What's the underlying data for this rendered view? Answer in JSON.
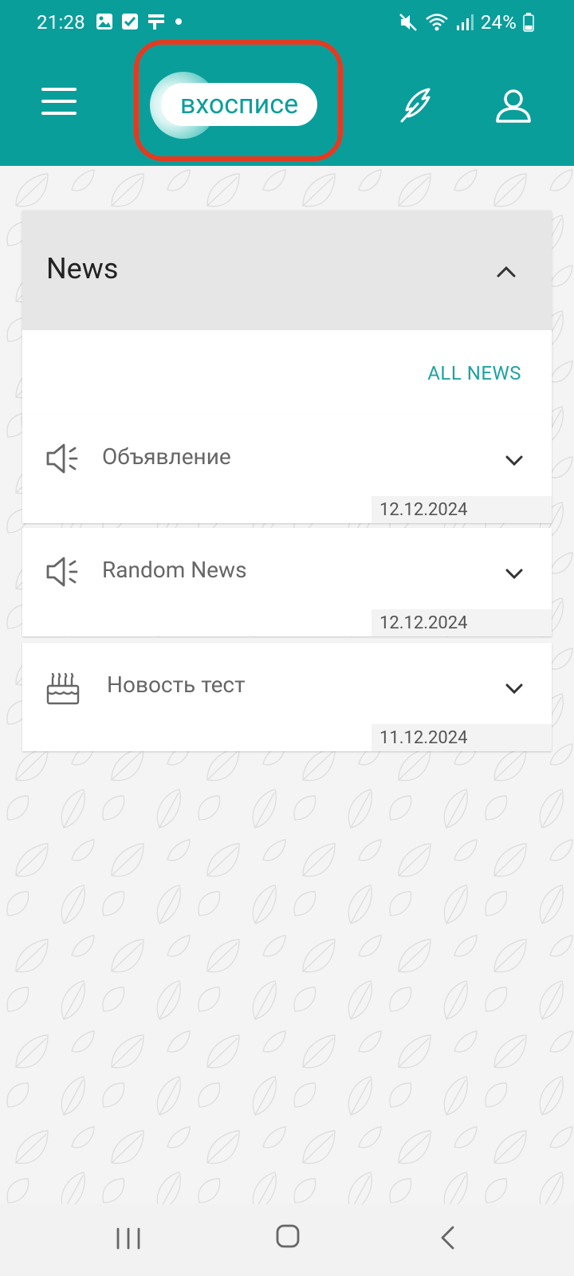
{
  "status_bar": {
    "time": "21:28",
    "battery_percent": "24%",
    "notification_icons": [
      "gallery-icon",
      "checkbox-icon",
      "app-icon",
      "dot-icon"
    ],
    "system_icons": [
      "mute-icon",
      "wifi-icon",
      "signal-icon",
      "battery-icon"
    ]
  },
  "header": {
    "logo_text": "вхосписе",
    "highlight_color": "#e63a20",
    "bar_color": "#0a9e9b"
  },
  "news_panel": {
    "title": "News",
    "all_news_label": "ALL NEWS",
    "items": [
      {
        "icon": "megaphone-icon",
        "title": "Объявление",
        "date": "12.12.2024"
      },
      {
        "icon": "megaphone-icon",
        "title": "Random News",
        "date": "12.12.2024"
      },
      {
        "icon": "cake-icon",
        "title": "Новость тест",
        "date": "11.12.2024"
      }
    ]
  }
}
